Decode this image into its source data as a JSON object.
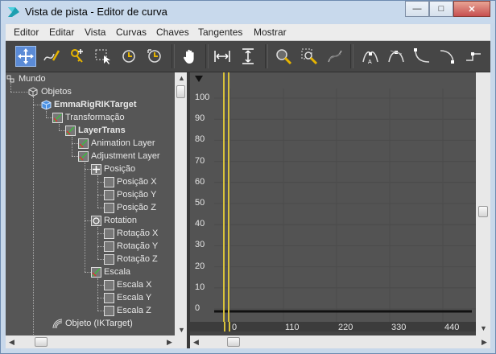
{
  "window": {
    "title": "Vista de pista - Editor de curva",
    "app_icon": "3ds-max-icon",
    "buttons": [
      "minimize-icon",
      "maximize-icon",
      "close-icon"
    ]
  },
  "menubar": {
    "items": [
      "Editor",
      "Editar",
      "Vista",
      "Curvas",
      "Chaves",
      "Tangentes",
      "Mostrar"
    ]
  },
  "toolbar": {
    "tools": [
      "move-keys-icon",
      "draw-curves-icon",
      "add-keys-icon",
      "region-select-icon",
      "retime-icon",
      "retime-all-icon",
      "pan-icon",
      "frame-horizontal-icon",
      "frame-value-icon",
      "zoom-icon",
      "zoom-region-icon",
      "isolate-curve-icon",
      "tangent-auto-icon",
      "tangent-spline-icon",
      "tangent-fast-icon",
      "tangent-slow-icon",
      "tangent-step-icon"
    ],
    "active": "move-keys-icon"
  },
  "tree": {
    "nodes": [
      {
        "label": "Mundo",
        "icon": "world-icon",
        "bold": false
      },
      {
        "label": "Objetos",
        "icon": "objects-icon",
        "bold": false
      },
      {
        "label": "EmmaRigRIKTarget",
        "icon": "object-cube-icon",
        "bold": true
      },
      {
        "label": "Transformação",
        "icon": "transform-icon",
        "bold": false
      },
      {
        "label": "LayerTrans",
        "icon": "layer-icon",
        "bold": true
      },
      {
        "label": "Animation Layer",
        "icon": "layer-icon",
        "bold": false
      },
      {
        "label": "Adjustment Layer",
        "icon": "layer-icon",
        "bold": false
      },
      {
        "label": "Posição",
        "icon": "position-icon",
        "bold": false
      },
      {
        "label": "Posição X",
        "icon": "float-track-icon",
        "bold": false
      },
      {
        "label": "Posição Y",
        "icon": "float-track-icon",
        "bold": false
      },
      {
        "label": "Posição Z",
        "icon": "float-track-icon",
        "bold": false
      },
      {
        "label": "Rotation",
        "icon": "rotation-icon",
        "bold": false
      },
      {
        "label": "Rotação X",
        "icon": "float-track-icon",
        "bold": false
      },
      {
        "label": "Rotação Y",
        "icon": "float-track-icon",
        "bold": false
      },
      {
        "label": "Rotação Z",
        "icon": "float-track-icon",
        "bold": false
      },
      {
        "label": "Escala",
        "icon": "scale-icon",
        "bold": false
      },
      {
        "label": "Escala X",
        "icon": "float-track-icon",
        "bold": false
      },
      {
        "label": "Escala Y",
        "icon": "float-track-icon",
        "bold": false
      },
      {
        "label": "Escala Z",
        "icon": "float-track-icon",
        "bold": false
      },
      {
        "label": "Objeto (IKTarget)",
        "icon": "ik-target-icon",
        "bold": false
      }
    ]
  },
  "graph": {
    "y_ticks": [
      "100",
      "90",
      "80",
      "70",
      "60",
      "50",
      "40",
      "30",
      "20",
      "10",
      "0"
    ],
    "x_ticks": [
      "0",
      "110",
      "220",
      "330",
      "440"
    ],
    "colors": {
      "background": "#535353",
      "time_slider": "#d8c23a",
      "curve": "#111111"
    }
  }
}
